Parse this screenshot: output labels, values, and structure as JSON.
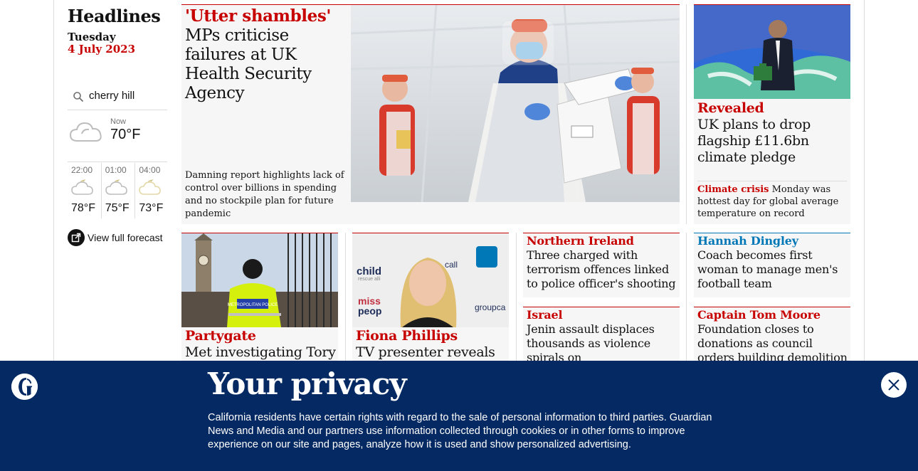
{
  "sidebar": {
    "title": "Headlines",
    "day": "Tuesday",
    "date": "4 July 2023",
    "location": "cherry hill",
    "now_label": "Now",
    "now_temp": "70°F",
    "forecast": [
      {
        "time": "22:00",
        "temp": "78°F",
        "icon": "partly-cloudy-night-icon"
      },
      {
        "time": "01:00",
        "temp": "75°F",
        "icon": "partly-cloudy-night-icon"
      },
      {
        "time": "04:00",
        "temp": "73°F",
        "icon": "partly-cloudy-night-icon"
      }
    ],
    "full_forecast_label": "View full forecast"
  },
  "stories": {
    "main": {
      "kicker": "'Utter shambles'",
      "headline": "MPs criticise failures at UK Health Security Agency",
      "standfirst": "Damning report highlights lack of control over billions in spending and no stockpile plan for future pandemic"
    },
    "right_top": {
      "kicker": "Revealed",
      "headline": "UK plans to drop flagship £11.6bn climate pledge",
      "sub_kicker": "Climate crisis",
      "sub_text": "Monday was hottest day for global average temperature on record"
    },
    "partygate": {
      "kicker": "Partygate",
      "headline": "Met investigating Tory"
    },
    "fiona": {
      "kicker": "Fiona Phillips",
      "headline": "TV presenter reveals"
    },
    "ni": {
      "kicker": "Northern Ireland",
      "headline": "Three charged with terrorism offences linked to police officer's shooting"
    },
    "israel": {
      "kicker": "Israel",
      "headline": "Jenin assault displaces thousands as violence spirals on"
    },
    "dingley": {
      "kicker": "Hannah Dingley",
      "headline": "Coach becomes first woman to manage men's football team"
    },
    "moore": {
      "kicker": "Captain Tom Moore",
      "headline": "Foundation closes to donations as council orders building demolition"
    }
  },
  "image_text": {
    "police_vest": "METROPOLITAN POLICE",
    "backdrop": [
      "child",
      "rescue alli",
      "miss",
      "peop",
      "call",
      "groupca"
    ]
  },
  "privacy": {
    "title": "Your privacy",
    "body": "California residents have certain rights with regard to the sale of personal information to third parties. Guardian News and Media and our partners use information collected through cookies or in other forms to improve experience on our site and pages, analyze how it is used and show personalized advertising."
  },
  "colors": {
    "news_red": "#c70000",
    "sport_blue": "#0077b6",
    "brand_navy": "#052962"
  }
}
